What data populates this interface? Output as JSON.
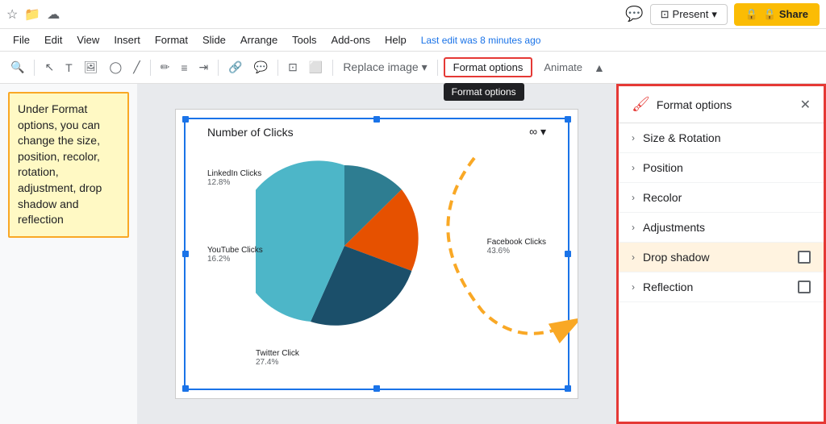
{
  "topbar": {
    "present_label": "Present",
    "share_label": "🔒 Share",
    "share_icon": "lock"
  },
  "menubar": {
    "items": [
      "File",
      "Edit",
      "View",
      "Insert",
      "Format",
      "Slide",
      "Arrange",
      "Tools",
      "Add-ons",
      "Help"
    ],
    "last_edit": "Last edit was 8 minutes ago"
  },
  "toolbar": {
    "format_options_label": "Format options",
    "format_options_tooltip": "Format options",
    "animate_label": "Animate"
  },
  "annotation": {
    "text": "Under Format options, you can change the size, position, recolor, rotation, adjustment, drop shadow and reflection"
  },
  "chart": {
    "title": "Number of Clicks",
    "segments": [
      {
        "label": "LinkedIn Clicks",
        "value": "12.8%",
        "color": "#2e7d91",
        "start": 0,
        "angle": 46
      },
      {
        "label": "YouTube Clicks",
        "value": "16.2%",
        "color": "#e65100",
        "start": 46,
        "angle": 58
      },
      {
        "label": "Twitter Click",
        "value": "27.4%",
        "color": "#1b4f6a",
        "start": 104,
        "angle": 99
      },
      {
        "label": "Facebook Clicks",
        "value": "43.6%",
        "color": "#4db6c8",
        "start": 203,
        "angle": 157
      }
    ]
  },
  "right_panel": {
    "title": "Format options",
    "icon": "🖌️",
    "items": [
      {
        "label": "Size & Rotation",
        "has_checkbox": false
      },
      {
        "label": "Position",
        "has_checkbox": false
      },
      {
        "label": "Recolor",
        "has_checkbox": false
      },
      {
        "label": "Adjustments",
        "has_checkbox": false
      },
      {
        "label": "Drop shadow",
        "has_checkbox": true
      },
      {
        "label": "Reflection",
        "has_checkbox": true
      }
    ]
  }
}
